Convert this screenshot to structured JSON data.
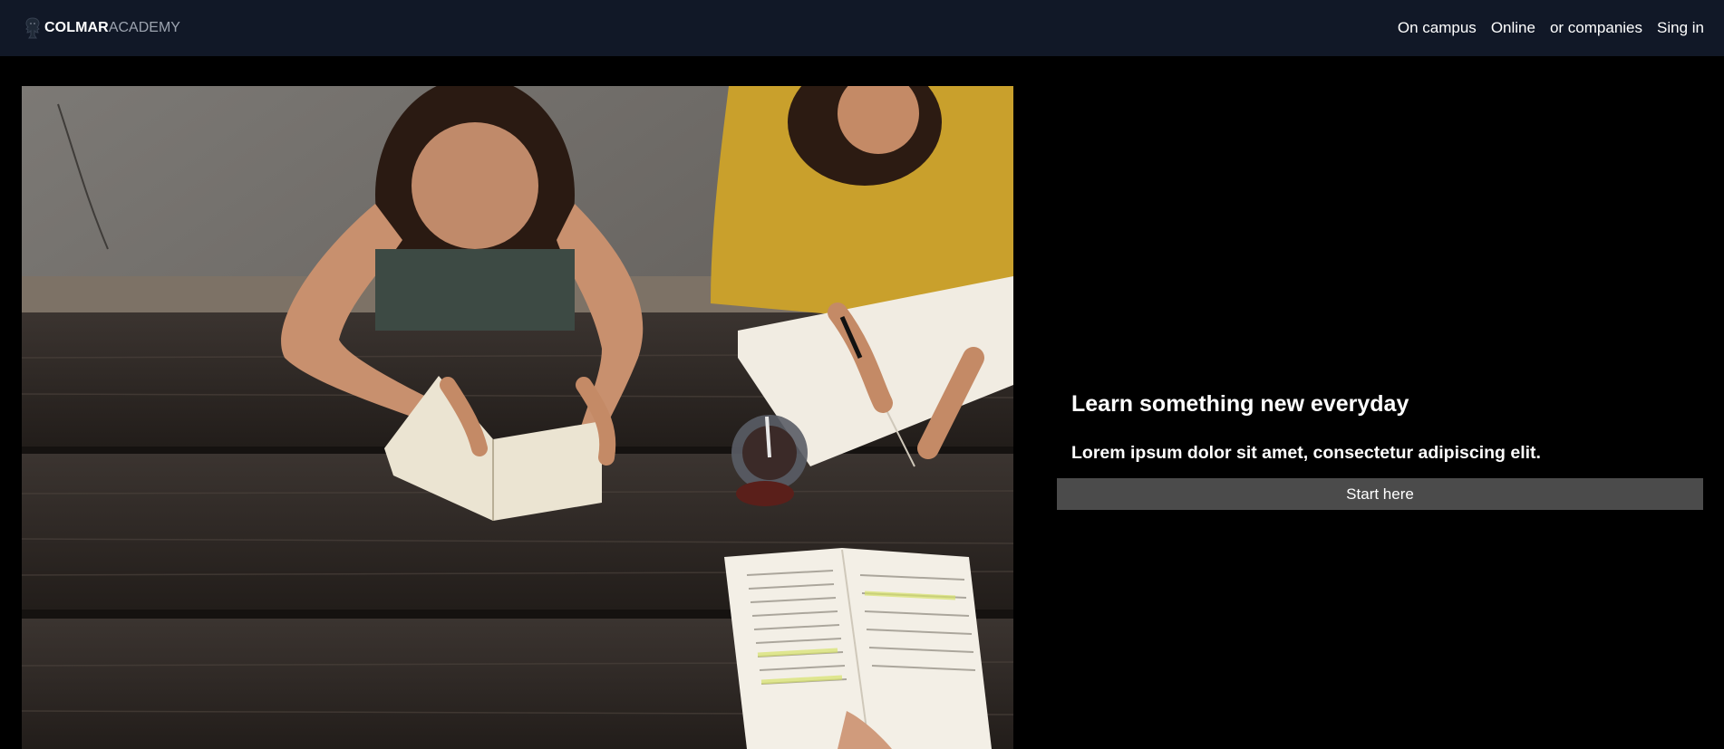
{
  "header": {
    "brand_bold": "COLMAR",
    "brand_light": "ACADEMY",
    "logo_icon": "lion-crest-icon",
    "nav": [
      {
        "label": "On campus"
      },
      {
        "label": "Online"
      },
      {
        "label": "or companies"
      },
      {
        "label": "Sing in"
      }
    ]
  },
  "hero": {
    "image_alt": "Two students reading and writing at a wooden picnic table",
    "title": "Learn something new everyday",
    "subtitle": "Lorem ipsum dolor sit amet, consectetur adipiscing elit.",
    "cta_label": "Start here"
  },
  "colors": {
    "header_bg": "#111827",
    "page_bg": "#000000",
    "button_bg": "#4b4b4b",
    "brand_light": "#9ca3af"
  }
}
